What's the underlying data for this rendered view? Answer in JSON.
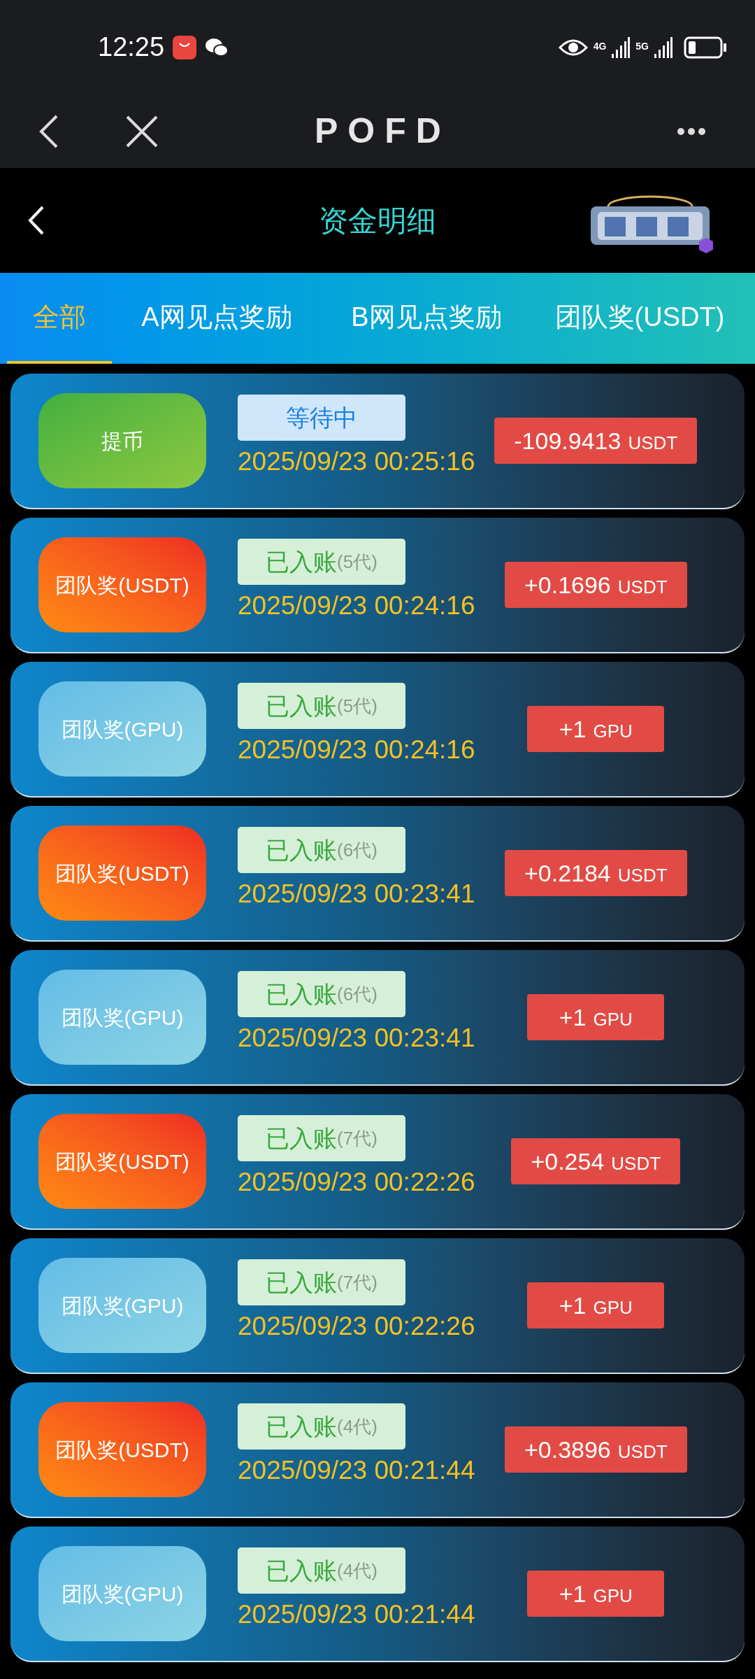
{
  "status_bar": {
    "time": "12:25",
    "network_1": "4G",
    "network_2": "5G"
  },
  "browser_bar": {
    "title": "POFD"
  },
  "header": {
    "title": "资金明细"
  },
  "tabs": [
    {
      "label": "全部",
      "selected": true
    },
    {
      "label": "A网见点奖励",
      "selected": false
    },
    {
      "label": "B网见点奖励",
      "selected": false
    },
    {
      "label": "团队奖(USDT)",
      "selected": false
    }
  ],
  "records": [
    {
      "kind": "withdraw",
      "type_label": "提币",
      "status": {
        "kind": "pending",
        "text": "等待中"
      },
      "date": "2025/09/23 00:25:16",
      "amount": "-109.9413",
      "unit": "USDT"
    },
    {
      "kind": "usdt",
      "type_label": "团队奖(USDT)",
      "status": {
        "kind": "credited",
        "text": "已入账",
        "generation": "(5代)"
      },
      "date": "2025/09/23 00:24:16",
      "amount": "+0.1696",
      "unit": "USDT"
    },
    {
      "kind": "gpu",
      "type_label": "团队奖(GPU)",
      "status": {
        "kind": "credited",
        "text": "已入账",
        "generation": "(5代)"
      },
      "date": "2025/09/23 00:24:16",
      "amount": "+1",
      "unit": "GPU"
    },
    {
      "kind": "usdt",
      "type_label": "团队奖(USDT)",
      "status": {
        "kind": "credited",
        "text": "已入账",
        "generation": "(6代)"
      },
      "date": "2025/09/23 00:23:41",
      "amount": "+0.2184",
      "unit": "USDT"
    },
    {
      "kind": "gpu",
      "type_label": "团队奖(GPU)",
      "status": {
        "kind": "credited",
        "text": "已入账",
        "generation": "(6代)"
      },
      "date": "2025/09/23 00:23:41",
      "amount": "+1",
      "unit": "GPU"
    },
    {
      "kind": "usdt",
      "type_label": "团队奖(USDT)",
      "status": {
        "kind": "credited",
        "text": "已入账",
        "generation": "(7代)"
      },
      "date": "2025/09/23 00:22:26",
      "amount": "+0.254",
      "unit": "USDT"
    },
    {
      "kind": "gpu",
      "type_label": "团队奖(GPU)",
      "status": {
        "kind": "credited",
        "text": "已入账",
        "generation": "(7代)"
      },
      "date": "2025/09/23 00:22:26",
      "amount": "+1",
      "unit": "GPU"
    },
    {
      "kind": "usdt",
      "type_label": "团队奖(USDT)",
      "status": {
        "kind": "credited",
        "text": "已入账",
        "generation": "(4代)"
      },
      "date": "2025/09/23 00:21:44",
      "amount": "+0.3896",
      "unit": "USDT"
    },
    {
      "kind": "gpu",
      "type_label": "团队奖(GPU)",
      "status": {
        "kind": "credited",
        "text": "已入账",
        "generation": "(4代)"
      },
      "date": "2025/09/23 00:21:44",
      "amount": "+1",
      "unit": "GPU"
    }
  ]
}
